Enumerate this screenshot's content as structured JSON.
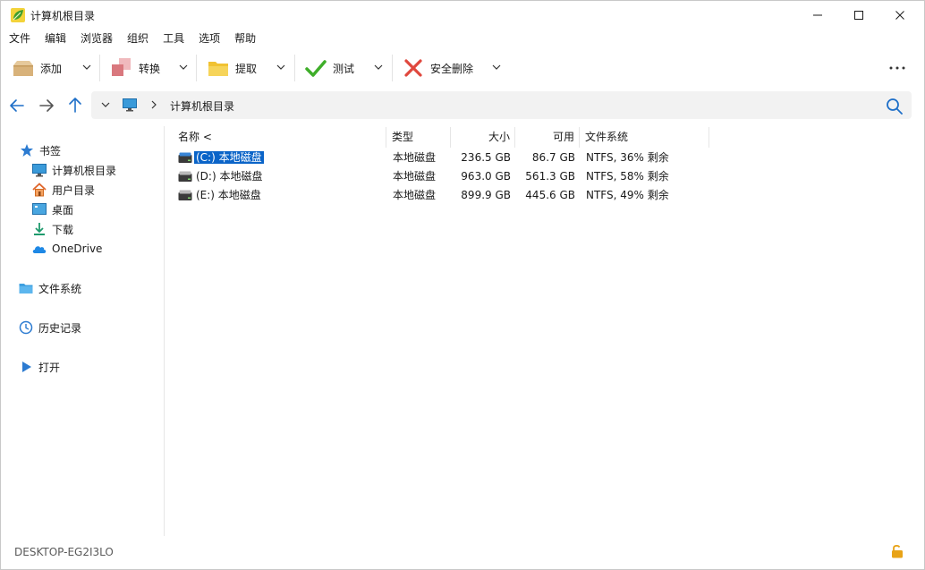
{
  "window": {
    "title": "计算机根目录"
  },
  "menu": [
    "文件",
    "编辑",
    "浏览器",
    "组织",
    "工具",
    "选项",
    "帮助"
  ],
  "toolbar": {
    "add": "添加",
    "convert": "转换",
    "extract": "提取",
    "test": "测试",
    "secure_delete": "安全删除"
  },
  "address": {
    "path": "计算机根目录"
  },
  "sidebar": {
    "bookmarks": "书签",
    "items": [
      "计算机根目录",
      "用户目录",
      "桌面",
      "下载",
      "OneDrive"
    ],
    "filesystem": "文件系统",
    "history": "历史记录",
    "open": "打开"
  },
  "columns": {
    "name": "名称 <",
    "type": "类型",
    "size": "大小",
    "free": "可用",
    "fs": "文件系统"
  },
  "rows": [
    {
      "name": "(C:) 本地磁盘",
      "type": "本地磁盘",
      "size": "236.5 GB",
      "free": "86.7 GB",
      "fs": "NTFS, 36% 剩余"
    },
    {
      "name": "(D:) 本地磁盘",
      "type": "本地磁盘",
      "size": "963.0 GB",
      "free": "561.3 GB",
      "fs": "NTFS, 58% 剩余"
    },
    {
      "name": "(E:) 本地磁盘",
      "type": "本地磁盘",
      "size": "899.9 GB",
      "free": "445.6 GB",
      "fs": "NTFS, 49% 剩余"
    }
  ],
  "status": {
    "computer": "DESKTOP-EG2I3LO"
  },
  "colors": {
    "accent": "#0a64c8",
    "add_icon": "#d8b27a",
    "convert_icon": "#d9787e",
    "extract_icon": "#f1c232",
    "test_icon": "#3fae2a",
    "delete_icon": "#e0483e",
    "lock": "#e8a317"
  },
  "icons": {
    "app": "green-leaf-icon",
    "bookmarks": "star-icon",
    "filesystem": "folder-icon",
    "history": "history-clock-icon",
    "open": "play-arrow-icon",
    "status": "unlocked-padlock-icon"
  }
}
